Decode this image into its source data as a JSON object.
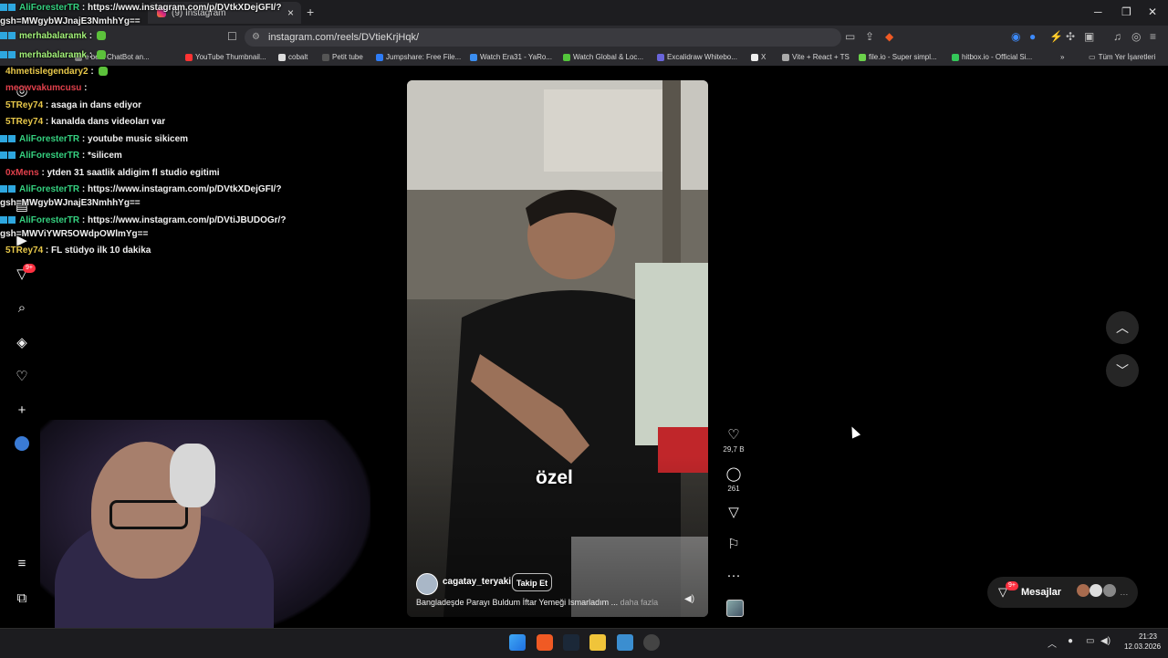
{
  "browser": {
    "tab_title": "(9) Instagram",
    "new_tab": "+",
    "url": "instagram.com/reels/DVtieKrjHqk/",
    "bookmarks": [
      {
        "label": "e best ChatBot an...",
        "color": "#888"
      },
      {
        "label": "YouTube Thumbnail...",
        "color": "#ff3333"
      },
      {
        "label": "cobalt",
        "color": "#ddd"
      },
      {
        "label": "Petit tube",
        "color": "#555"
      },
      {
        "label": "Jumpshare: Free File...",
        "color": "#2e7cf6"
      },
      {
        "label": "Watch Era31 - YaRo...",
        "color": "#3b8ef0"
      },
      {
        "label": "Watch Global & Loc...",
        "color": "#53c53b"
      },
      {
        "label": "Excalidraw Whitebo...",
        "color": "#6965db"
      },
      {
        "label": "X",
        "color": "#eee"
      },
      {
        "label": "Vite + React + TS",
        "color": "#aaa"
      },
      {
        "label": "file.io - Super simpl...",
        "color": "#6bd14b"
      },
      {
        "label": "hitbox.io - Official Si...",
        "color": "#34c759"
      }
    ],
    "all_bookmarks": "Tüm Yer İşaretleri",
    "more": "»"
  },
  "chat": [
    {
      "user": "AliForesterTR",
      "msg": "https://www.instagram.com/p/DVtkXDejGFI/?",
      "color": "#35d07f",
      "badge": true
    },
    {
      "user": "",
      "msg": "gsh=MWgybWJnajE3NmhhYg==",
      "color": "#fff",
      "badge": false
    },
    {
      "user": "merhabalaramk",
      "msg": "",
      "color": "#a4f27a",
      "badge": true,
      "emote": true
    },
    {
      "user": "merhabalaramk",
      "msg": "",
      "color": "#a4f27a",
      "badge": true,
      "emote": true
    },
    {
      "user": "4hmetislegendary2",
      "msg": "",
      "color": "#e8c84a",
      "badge": false,
      "emote": true
    },
    {
      "user": "meowvakumcusu",
      "msg": "",
      "color": "#e0404b",
      "badge": false
    },
    {
      "user": "5TRey74",
      "msg": "asaga in dans ediyor",
      "color": "#e8c84a",
      "badge": false
    },
    {
      "user": "5TRey74",
      "msg": "kanalda dans videoları var",
      "color": "#e8c84a",
      "badge": false
    },
    {
      "user": "AliForesterTR",
      "msg": "youtube music sikicem",
      "color": "#35d07f",
      "badge": true
    },
    {
      "user": "AliForesterTR",
      "msg": "*silicem",
      "color": "#35d07f",
      "badge": true
    },
    {
      "user": "0xMens",
      "msg": "ytden 31 saatlik aldigim fl studio egitimi",
      "color": "#e0404b",
      "badge": false
    },
    {
      "user": "AliForesterTR",
      "msg": "https://www.instagram.com/p/DVtkXDejGFI/?",
      "color": "#35d07f",
      "badge": true
    },
    {
      "user": "",
      "msg": "gsh=MWgybWJnajE3NmhhYg==",
      "color": "#fff",
      "badge": false
    },
    {
      "user": "AliForesterTR",
      "msg": "https://www.instagram.com/p/DVtiJBUDOGr/?",
      "color": "#35d07f",
      "badge": true
    },
    {
      "user": "",
      "msg": "gsh=MWViYWR5OWdpOWlmYg==",
      "color": "#fff",
      "badge": false
    },
    {
      "user": "5TRey74",
      "msg": "FL stüdyo ilk 10 dakika",
      "color": "#e8c84a",
      "badge": false
    }
  ],
  "sidebar": {
    "notifications_badge": "9+",
    "icons": [
      "home-icon",
      "reels-icon",
      "messages-icon",
      "search-icon",
      "explore-icon",
      "heart-icon",
      "create-icon",
      "profile-icon",
      "menu-icon",
      "apps-icon"
    ]
  },
  "reel": {
    "caption_overlay": "özel",
    "author": "cagatay_teryaki",
    "follow": "Takip Et",
    "description": "Bangladeşde Parayı Buldum İftar Yemeği Ismarladım ...",
    "more": "daha fazla",
    "likes": "29,7 B",
    "comments": "261"
  },
  "messages": {
    "label": "Mesajlar",
    "badge": "9+"
  },
  "taskbar": {
    "time": "21:23",
    "date": "12.03.2026"
  }
}
